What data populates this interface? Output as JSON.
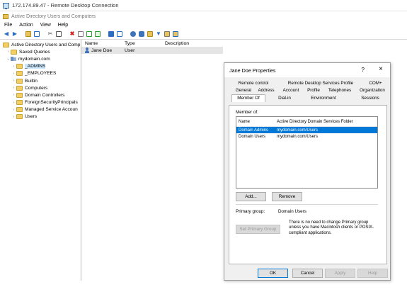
{
  "rdp": {
    "title": "172.174.89.47 - Remote Desktop Connection"
  },
  "app": {
    "title": "Active Directory Users and Computers"
  },
  "menu": [
    "File",
    "Action",
    "View",
    "Help"
  ],
  "toolbar_icons": [
    "back-arrow-icon",
    "forward-arrow-icon",
    "folder-up-icon",
    "console-tree-icon",
    "cut-icon",
    "copy-icon",
    "delete-icon",
    "properties-icon",
    "refresh-icon",
    "export-list-icon",
    "help-icon",
    "mmc-icon",
    "new-user-icon",
    "new-group-icon",
    "new-ou-icon",
    "filter-icon",
    "find-icon",
    "add-to-group-icon"
  ],
  "tree": {
    "root": "Active Directory Users and Comp",
    "saved_queries": "Saved Queries",
    "domain": "mydomain.com",
    "children": [
      "_ADMINS",
      "_EMPLOYEES",
      "Builtin",
      "Computers",
      "Domain Controllers",
      "ForeignSecurityPrincipals",
      "Managed Service Accoun",
      "Users"
    ]
  },
  "list": {
    "headers": {
      "name": "Name",
      "type": "Type",
      "description": "Description"
    },
    "row": {
      "name": "Jane Doe",
      "type": "User"
    }
  },
  "dialog": {
    "title": "Jane Doe Properties",
    "help": "?",
    "close": "×",
    "tabs_row1": [
      "Remote control",
      "Remote Desktop Services Profile",
      "COM+"
    ],
    "tabs_row2": [
      "General",
      "Address",
      "Account",
      "Profile",
      "Telephones",
      "Organization"
    ],
    "tabs_row3": [
      "Member Of",
      "Dial-in",
      "Environment",
      "Sessions"
    ],
    "memberof_label": "Member of:",
    "members_headers": {
      "name": "Name",
      "folder": "Active Directory Domain Services Folder"
    },
    "members": [
      {
        "name": "Domain Admins",
        "folder": "mydomain.com/Users"
      },
      {
        "name": "Domain Users",
        "folder": "mydomain.com/Users"
      }
    ],
    "add_button": "Add...",
    "remove_button": "Remove",
    "primary_group_label": "Primary group:",
    "primary_group_value": "Domain Users",
    "set_primary_button": "Set Primary Group",
    "note": "There is no need to change Primary group unless you have Macintosh clients or POSIX-compliant applications.",
    "ok_button": "OK",
    "cancel_button": "Cancel",
    "apply_button": "Apply",
    "help_button": "Help"
  }
}
